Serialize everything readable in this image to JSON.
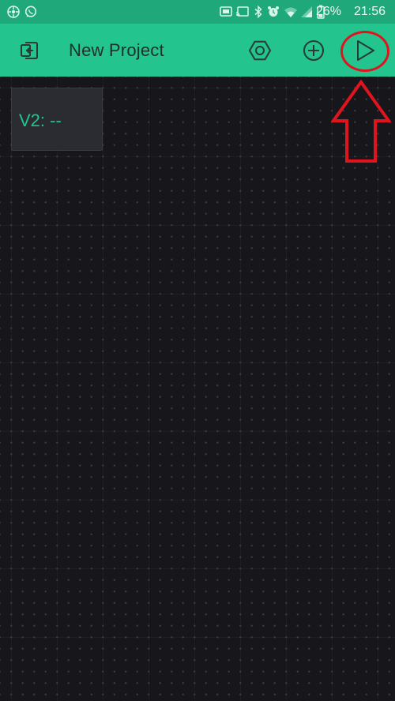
{
  "status_bar": {
    "battery_percent": "26%",
    "time": "21:56",
    "icons": [
      "app-notification-icon",
      "whatsapp-icon",
      "cast-icon",
      "bluetooth-icon",
      "alarm-icon",
      "wifi-icon",
      "cellular-signal-icon",
      "battery-icon"
    ]
  },
  "toolbar": {
    "title": "New Project",
    "back_icon": "exit-project-icon",
    "settings_icon": "hexagon-settings-icon",
    "add_icon": "add-widget-icon",
    "play_icon": "play-icon"
  },
  "canvas": {
    "widgets": [
      {
        "type": "value-display",
        "label": "V2: --",
        "color": "#23c48e"
      }
    ]
  },
  "annotation": {
    "color": "#e0141e",
    "highlight": "play-button",
    "shapes": [
      "circle",
      "up-arrow"
    ]
  },
  "colors": {
    "toolbar": "#23c48e",
    "status_bar": "#1fa97a",
    "canvas": "#17171b",
    "widget_bg": "#2b2c31",
    "accent": "#23c48e"
  }
}
